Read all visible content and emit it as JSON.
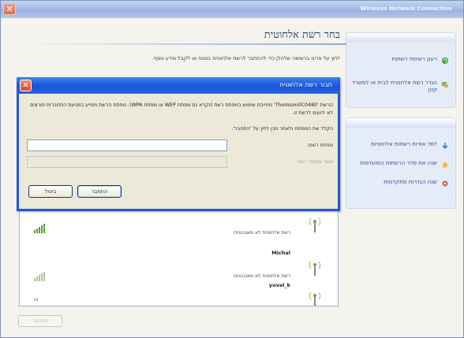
{
  "window": {
    "title": "Wireless Network Connection",
    "close_glyph": "✕"
  },
  "task_pane": {
    "group1": [
      {
        "label": "רענן רשימת רשתות",
        "icon": "refresh-icon"
      },
      {
        "label": "הגדר רשת אלחוטית לבית או למשרד קטן",
        "icon": "home-network-icon"
      }
    ],
    "group2": [
      {
        "label": "למד אודות רשתות אלחוטיות",
        "icon": "learn-icon"
      },
      {
        "label": "שנה את סדר הרשתות המועדפות",
        "icon": "star-icon"
      },
      {
        "label": "שנה הגדרות מתקדמות",
        "icon": "settings-icon"
      }
    ]
  },
  "main": {
    "title": "בחר רשת אלחוטית",
    "description": "לחץ על פריט ברשימה שלהלן כדי להתחבר לרשת אלחוטית בטווח או לקבל מידע נוסף.",
    "networks": [
      {
        "name": "",
        "security": "רשת אלחוטית לא מאובטחת",
        "signal_bars": 4
      },
      {
        "name": "Michal",
        "security": "רשת אלחוטית לא מאובטחת",
        "signal_bars": 2
      },
      {
        "name": "yuval_k",
        "security": "",
        "signal_bars": 1
      }
    ],
    "connect_label": "התחבר"
  },
  "dialog": {
    "title": "חבור רשת אלחוטית",
    "close_glyph": "✕",
    "message": "הרשת 'Thomson0C0480' מחייבת שימוש במפתח רשת (נקרא גם מפתח WEP או מפתח WPA). מפתח הרשת מסייע במניעת התחברות פורצים לא ידועים לרשת זו.",
    "instruction": "הקלד את המפתח ולאחר מכן לחץ על 'התחבר'.",
    "key_label": "מפתח רשת:",
    "confirm_label": "אשר מפתח רשת:",
    "key_value": "",
    "confirm_value": "",
    "connect_label": "התחבר",
    "cancel_label": "ביטול"
  }
}
